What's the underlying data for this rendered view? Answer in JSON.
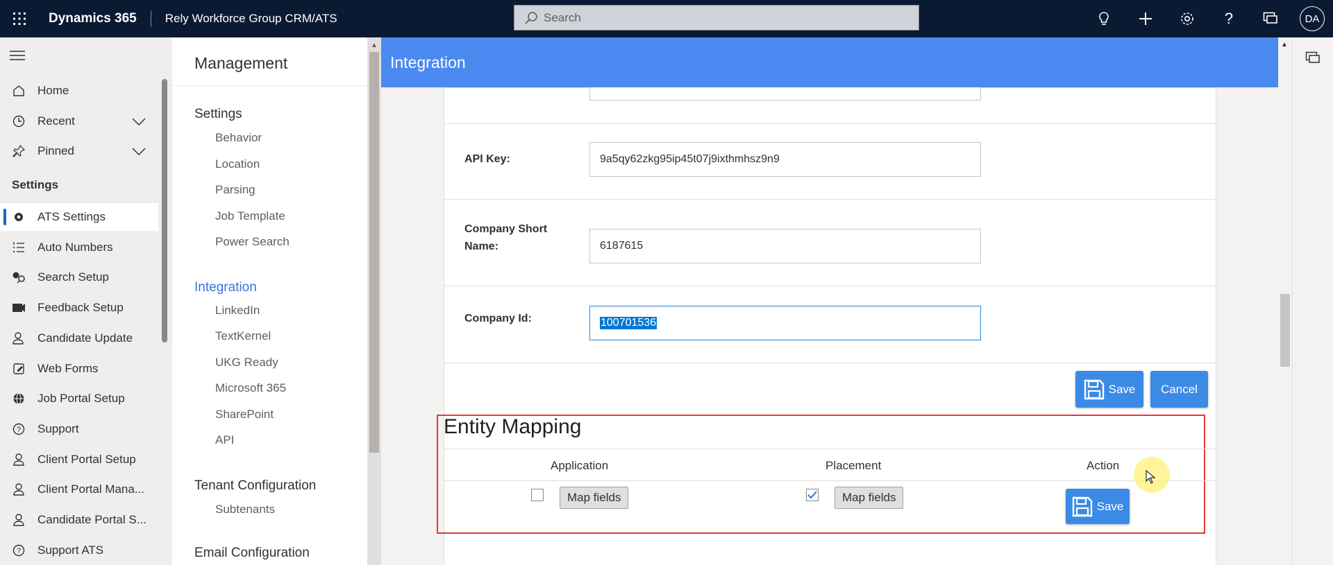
{
  "topbar": {
    "brand": "Dynamics 365",
    "app_name": "Rely Workforce Group CRM/ATS",
    "search_placeholder": "Search",
    "avatar_initials": "DA"
  },
  "leftnav": {
    "items": [
      {
        "label": "Home",
        "icon": "home-icon"
      },
      {
        "label": "Recent",
        "icon": "clock-icon"
      },
      {
        "label": "Pinned",
        "icon": "pin-icon"
      }
    ],
    "section_header": "Settings",
    "settings_items": [
      {
        "label": "ATS Settings",
        "icon": "gear-icon"
      },
      {
        "label": "Auto Numbers",
        "icon": "numbered-list-icon"
      },
      {
        "label": "Search Setup",
        "icon": "search-setup-icon"
      },
      {
        "label": "Feedback Setup",
        "icon": "feedback-icon"
      },
      {
        "label": "Candidate Update",
        "icon": "people-icon"
      },
      {
        "label": "Web Forms",
        "icon": "forms-icon"
      },
      {
        "label": "Job Portal Setup",
        "icon": "globe-icon"
      },
      {
        "label": "Support",
        "icon": "help-icon"
      },
      {
        "label": "Client Portal Setup",
        "icon": "person-icon"
      },
      {
        "label": "Client Portal Mana...",
        "icon": "person-icon"
      },
      {
        "label": "Candidate Portal S...",
        "icon": "person-icon"
      },
      {
        "label": "Support ATS",
        "icon": "help-icon"
      }
    ]
  },
  "management": {
    "title": "Management",
    "settings_label": "Settings",
    "settings_items": [
      "Behavior",
      "Location",
      "Parsing",
      "Job Template",
      "Power Search"
    ],
    "integration_label": "Integration",
    "integration_items": [
      "LinkedIn",
      "TextKernel",
      "UKG Ready",
      "Microsoft 365",
      "SharePoint",
      "API"
    ],
    "tenant_label": "Tenant Configuration",
    "tenant_items": [
      "Subtenants"
    ],
    "email_label": "Email Configuration"
  },
  "integration": {
    "header": "Integration",
    "fields": {
      "api_key_label": "API Key:",
      "api_key_value": "9a5qy62zkg95ip45t07j9ixthmhsz9n9",
      "company_short_label_1": "Company Short",
      "company_short_label_2": "Name:",
      "company_short_value": "6187615",
      "company_id_label": "Company Id:",
      "company_id_value": "100701536"
    },
    "save_label": "Save",
    "cancel_label": "Cancel",
    "entity_mapping": {
      "title": "Entity Mapping",
      "columns": [
        "Application",
        "Placement",
        "Action"
      ],
      "application_checked": false,
      "placement_checked": true,
      "map_fields_label": "Map fields",
      "save_label": "Save"
    }
  },
  "colors": {
    "topbar": "#0a1a33",
    "header_blue": "#4a8af0",
    "button_blue": "#3b8ae6",
    "highlight_red": "#e03a3a"
  }
}
